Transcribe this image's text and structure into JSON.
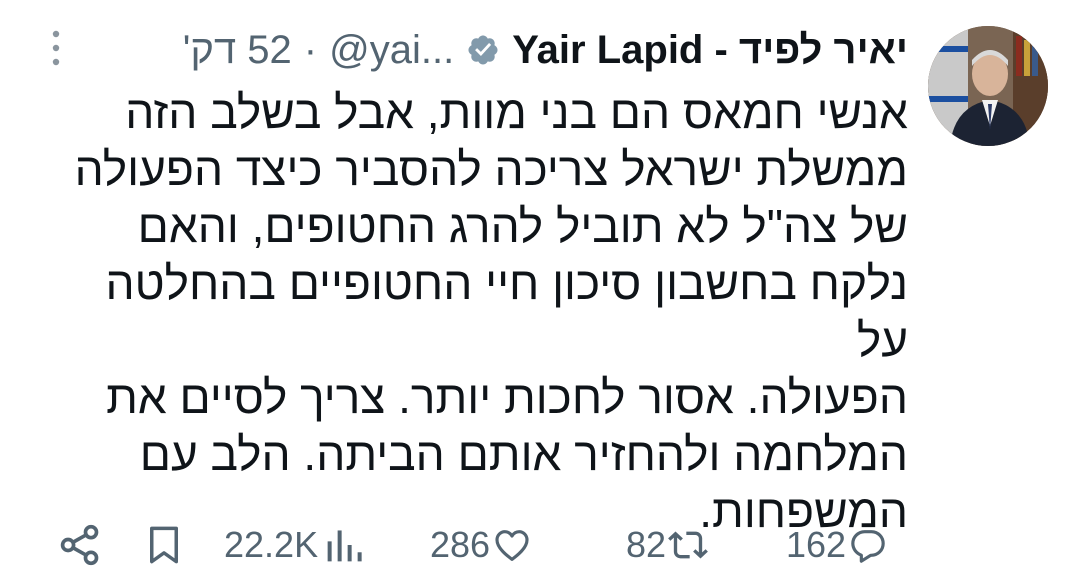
{
  "tweet": {
    "display_name": "יאיר לפיד - Yair Lapid",
    "handle": "@yai...",
    "separator": "·",
    "time": "52 דק'",
    "text": "אנשי חמאס הם בני מוות, אבל בשלב הזה\nממשלת ישראל צריכה להסביר כיצד הפעולה\nשל צה\"ל לא תוביל להרג החטופים, והאם\nנלקח בחשבון סיכון חיי החטופיים בהחלטה על\nהפעולה. אסור לחכות יותר. צריך לסיים את\nהמלחמה ולהחזיר אותם הביתה. הלב עם\nהמשפחות."
  },
  "actions": {
    "replies": "162",
    "retweets": "82",
    "likes": "286",
    "views": "22.2K"
  },
  "icons": {
    "more": "more-vertical-icon",
    "verified": "verified-badge-icon",
    "reply": "reply-icon",
    "retweet": "retweet-icon",
    "like": "heart-icon",
    "views": "views-chart-icon",
    "bookmark": "bookmark-icon",
    "share": "share-icon"
  },
  "colors": {
    "text": "#0f1419",
    "secondary": "#536471",
    "verified": "#829aab"
  }
}
